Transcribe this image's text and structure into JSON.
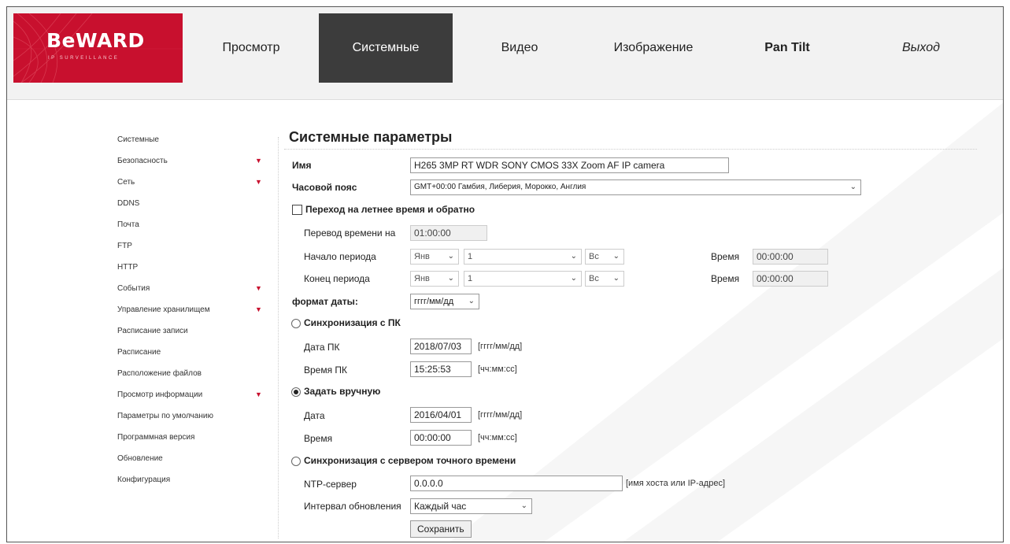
{
  "brand": {
    "logo": "BeWARD",
    "subtitle": "IP SURVEILLANCE",
    "accent": "#c8102e"
  },
  "nav": [
    "Просмотр",
    "Системные",
    "Видео",
    "Изображение",
    "Pan Tilt",
    "Выход"
  ],
  "sidebar": [
    {
      "label": "Системные",
      "expandable": false
    },
    {
      "label": "Безопасность",
      "expandable": true
    },
    {
      "label": "Сеть",
      "expandable": true
    },
    {
      "label": "DDNS",
      "expandable": false
    },
    {
      "label": "Почта",
      "expandable": false
    },
    {
      "label": "FTP",
      "expandable": false
    },
    {
      "label": "HTTP",
      "expandable": false
    },
    {
      "label": "События",
      "expandable": true
    },
    {
      "label": "Управление хранилищем",
      "expandable": true
    },
    {
      "label": "Расписание записи",
      "expandable": false
    },
    {
      "label": "Расписание",
      "expandable": false
    },
    {
      "label": "Расположение файлов",
      "expandable": false
    },
    {
      "label": "Просмотр информации",
      "expandable": true
    },
    {
      "label": "Параметры по умолчанию",
      "expandable": false
    },
    {
      "label": "Программная версия",
      "expandable": false
    },
    {
      "label": "Обновление",
      "expandable": false
    },
    {
      "label": "Конфигурация",
      "expandable": false
    }
  ],
  "page": {
    "title": "Системные параметры",
    "name_label": "Имя",
    "name_value": "H265 3MP RT WDR SONY CMOS 33X Zoom AF IP camera",
    "tz_label": "Часовой пояс",
    "tz_value": "GMT+00:00 Гамбия, Либерия, Морокко, Англия",
    "dst_label": "Переход на летнее время и обратно",
    "shift_label": "Перевод времени на",
    "shift_value": "01:00:00",
    "start_label": "Начало периода",
    "start_month": "Янв",
    "start_week": "1",
    "start_day": "Вс",
    "start_time_label": "Время",
    "start_time": "00:00:00",
    "end_label": "Конец периода",
    "end_month": "Янв",
    "end_week": "1",
    "end_day": "Вс",
    "end_time_label": "Время",
    "end_time": "00:00:00",
    "date_format_label": "формат даты:",
    "date_format_value": "гггг/мм/дд",
    "sync_pc_label": "Синхронизация с ПК",
    "pc_date_label": "Дата ПК",
    "pc_date_value": "2018/07/03",
    "pc_date_hint": "[гггг/мм/дд]",
    "pc_time_label": "Время ПК",
    "pc_time_value": "15:25:53",
    "pc_time_hint": "[чч:мм:сс]",
    "manual_label": "Задать вручную",
    "date_label": "Дата",
    "date_value": "2016/04/01",
    "date_hint": "[гггг/мм/дд]",
    "time_label": "Время",
    "time_value": "00:00:00",
    "time_hint": "[чч:мм:сс]",
    "ntp_sync_label": "Синхронизация с сервером точного времени",
    "ntp_label": "NTP-сервер",
    "ntp_value": "0.0.0.0",
    "ntp_hint": "[имя хоста или IP-адрес]",
    "interval_label": "Интервал обновления",
    "interval_value": "Каждый час",
    "save_label": "Сохранить",
    "selected_mode": "manual"
  }
}
